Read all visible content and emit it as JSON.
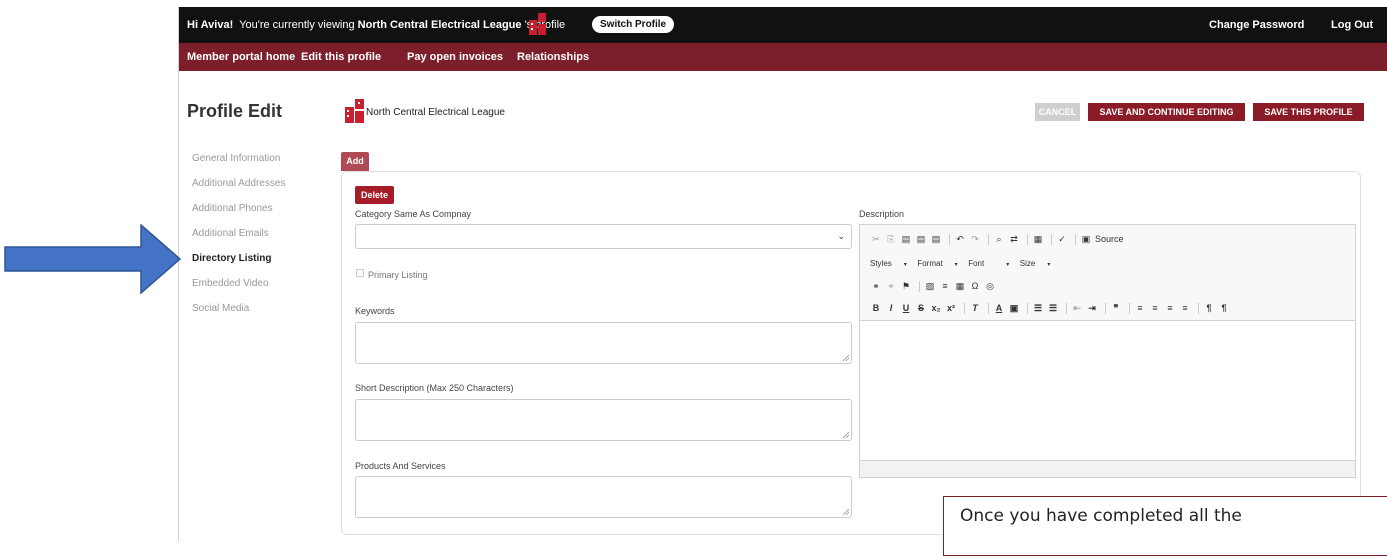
{
  "topbar": {
    "greeting_prefix": "Hi Aviva!",
    "greeting_middle": "You're currently viewing",
    "org_name": "North Central Electrical League",
    "greeting_suffix": "'s profile",
    "switch_profile": "Switch Profile",
    "change_password": "Change Password",
    "log_out": "Log Out"
  },
  "nav": {
    "home": "Member portal home",
    "edit": "Edit this profile",
    "pay": "Pay open invoices",
    "relationships": "Relationships"
  },
  "page": {
    "title": "Profile Edit",
    "org_name": "North Central Electrical League",
    "cancel": "CANCEL",
    "save_continue": "SAVE AND CONTINUE EDITING",
    "save_profile": "SAVE THIS PROFILE"
  },
  "sidebar": {
    "items": [
      {
        "label": "General Information"
      },
      {
        "label": "Additional Addresses"
      },
      {
        "label": "Additional Phones"
      },
      {
        "label": "Additional Emails"
      },
      {
        "label": "Directory Listing"
      },
      {
        "label": "Embedded Video"
      },
      {
        "label": "Social Media"
      }
    ],
    "active_index": 4
  },
  "form": {
    "add": "Add",
    "delete": "Delete",
    "category_label": "Category Same As Compnay",
    "category_value": "",
    "primary_listing": "Primary Listing",
    "keywords_label": "Keywords",
    "short_desc_label": "Short Description (Max 250 Characters)",
    "products_label": "Products And Services",
    "description_label": "Description"
  },
  "editor": {
    "source": "Source",
    "styles": "Styles",
    "format": "Format",
    "font": "Font",
    "size": "Size"
  },
  "callout": {
    "text": "Once you have completed all the"
  },
  "colors": {
    "topbar": "#111111",
    "navbar": "#7d1f2b",
    "accent": "#8b1b27",
    "arrow": "#4472c4"
  }
}
